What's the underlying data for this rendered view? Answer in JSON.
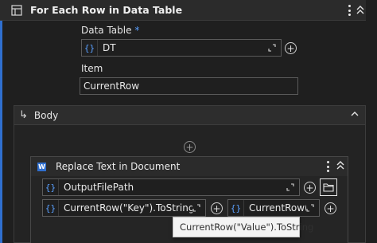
{
  "activity": {
    "title": "For Each Row in Data Table",
    "data_table_label": "Data Table",
    "required_mark": "*",
    "data_table_value": "DT",
    "item_label": "Item",
    "item_value": "CurrentRow"
  },
  "body": {
    "title": "Body",
    "arrow": "↳"
  },
  "inner": {
    "title": "Replace Text in Document",
    "word_icon_letter": "W",
    "file_value": "OutputFilePath",
    "key_value": "CurrentRow(\"Key\").ToString.Trim",
    "value_value": "CurrentRow(\"Va"
  },
  "tooltip": {
    "text": "CurrentRow(\"Value\").ToString"
  },
  "icons": {
    "brace": "{}",
    "plus": "+"
  },
  "colors": {
    "accent": "#2f6fcf",
    "brace": "#5aa0ff"
  }
}
